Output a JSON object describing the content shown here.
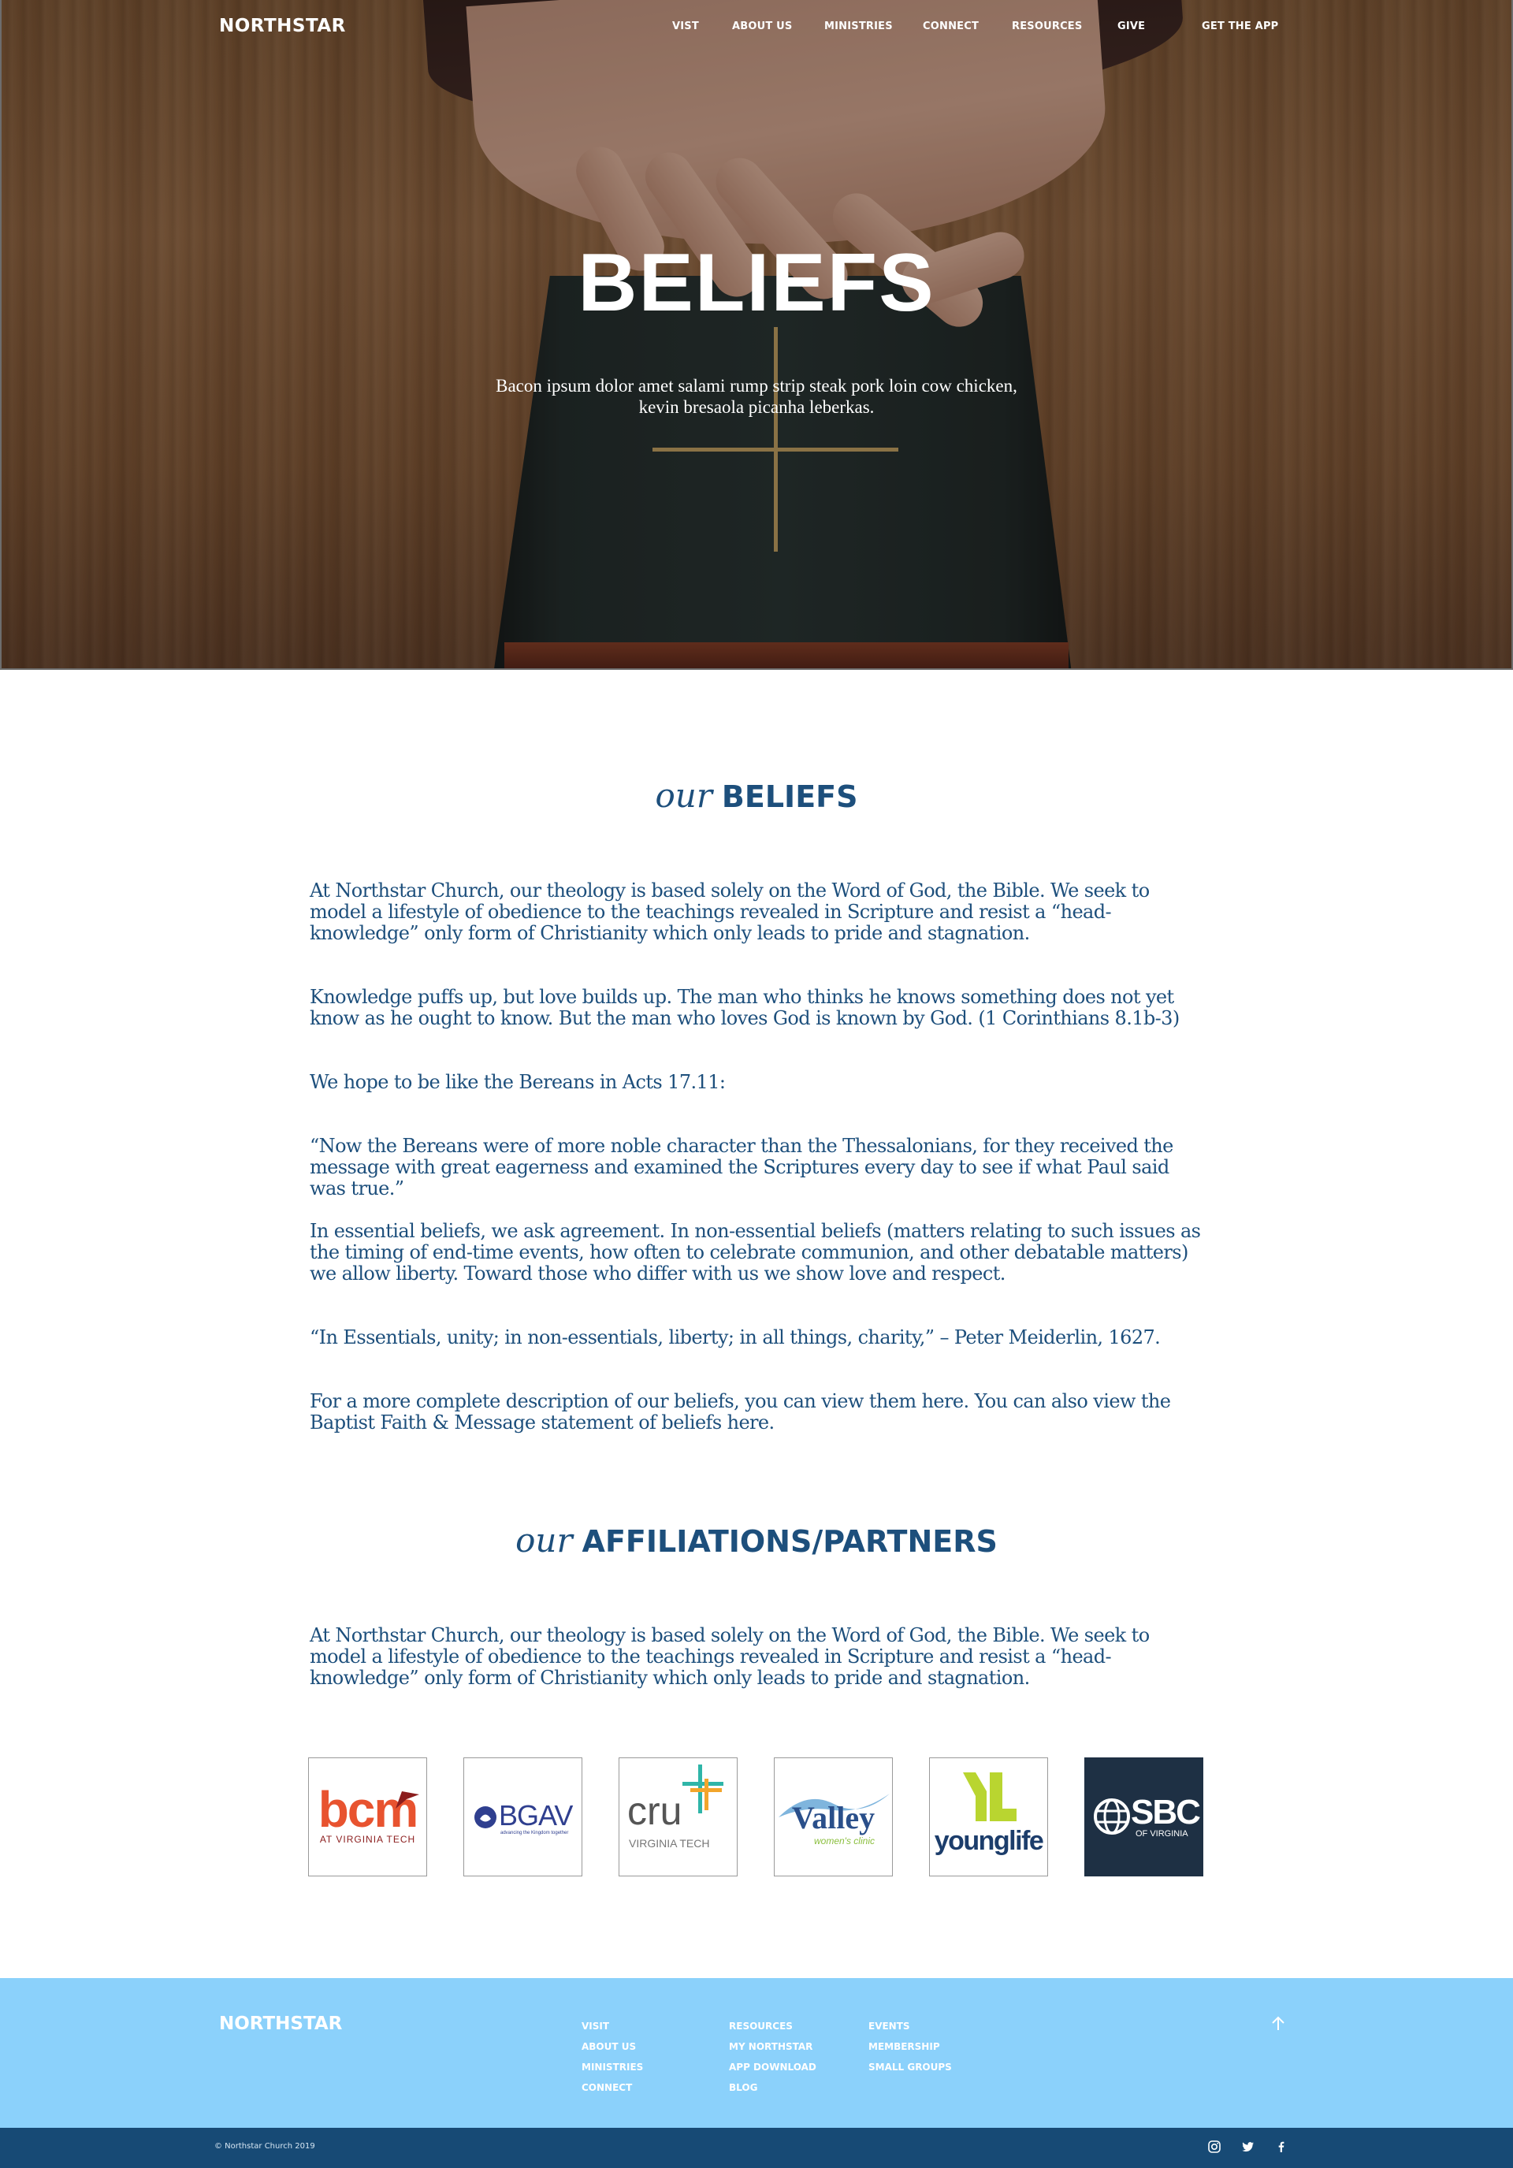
{
  "brand": "NORTHSTAR",
  "nav": {
    "links": [
      "VIST",
      "ABOUT US",
      "MINISTRIES",
      "CONNECT",
      "RESOURCES",
      "GIVE"
    ],
    "cta": "GET THE APP"
  },
  "hero": {
    "title": "BELIEFS",
    "subtitle": "Bacon ipsum dolor amet salami rump strip steak pork loin cow chicken, kevin bresaola picanha leberkas."
  },
  "beliefs": {
    "title_em": "our",
    "title_strong": "BELIEFS",
    "paragraphs": [
      "At Northstar Church, our theology is based solely on the Word of God, the Bible. We seek to model a lifestyle of obedience to the teachings revealed in Scripture and resist a “head-knowledge” only form of Christianity which only leads to pride and stagnation.",
      "Knowledge puffs up, but love builds up. The man who thinks he knows something does not yet know as he ought to know. But the man who loves God is known by God. (1 Corinthians 8.1b-3)",
      "We hope to be like the Bereans in Acts 17.11:",
      "“Now the Bereans were of more noble character than the Thessalonians, for they received the message with great eagerness and examined the Scriptures every day to see if what Paul said was true.”",
      "In essential beliefs, we ask agreement. In non-essential beliefs (matters relating to such issues as the timing of end-time events, how often to celebrate communion, and other debatable matters) we allow liberty. Toward those who differ with us we show love and respect.",
      "“In Essentials, unity; in non-essentials, liberty; in all things, charity,” – Peter Meiderlin, 1627.",
      "For a more complete description of our beliefs, you can view them here. You can also view the Baptist Faith & Message statement of beliefs here."
    ]
  },
  "affiliations": {
    "title_em": "our",
    "title_strong": "AFFILIATIONS/PARTNERS",
    "paragraph": "At Northstar Church, our theology is based solely on the Word of God, the Bible. We seek to model a lifestyle of obedience to the teachings revealed in Scripture and resist a “head-knowledge” only form of Christianity which only leads to pride and stagnation.",
    "logos": [
      {
        "name": "bcm",
        "text": "bcm",
        "sub": "AT VIRGINIA TECH",
        "color": "#e8532f"
      },
      {
        "name": "bgav",
        "text": "BGAV",
        "sub": "advancing the Kingdom together",
        "color": "#2f3f8f"
      },
      {
        "name": "cru",
        "text": "cru",
        "sub": "VIRGINIA TECH",
        "color": "#555555"
      },
      {
        "name": "valley",
        "text": "Valley",
        "sub": "women's clinic",
        "color": "#2a4f8a"
      },
      {
        "name": "younglife",
        "text": "younglife",
        "color": "#1c3d6b",
        "accent": "#b9d530"
      },
      {
        "name": "sbc",
        "text": "SBC",
        "sub": "OF VIRGINIA",
        "color": "#1e3044"
      }
    ]
  },
  "footer": {
    "brand": "NORTHSTAR",
    "col1": [
      "VISIT",
      "ABOUT US",
      "MINISTRIES",
      "CONNECT"
    ],
    "col2": [
      "RESOURCES",
      "MY NORTHSTAR",
      "APP DOWNLOAD",
      "BLOG"
    ],
    "col3": [
      "EVENTS",
      "MEMBERSHIP",
      "SMALL GROUPS"
    ],
    "copyright": "© Northstar Church 2019",
    "social_icons": [
      "instagram-icon",
      "twitter-icon",
      "facebook-icon"
    ]
  },
  "colors": {
    "primary": "#1d4f7c",
    "footer_light": "#8bd1fb",
    "footer_dark": "#174a75"
  }
}
